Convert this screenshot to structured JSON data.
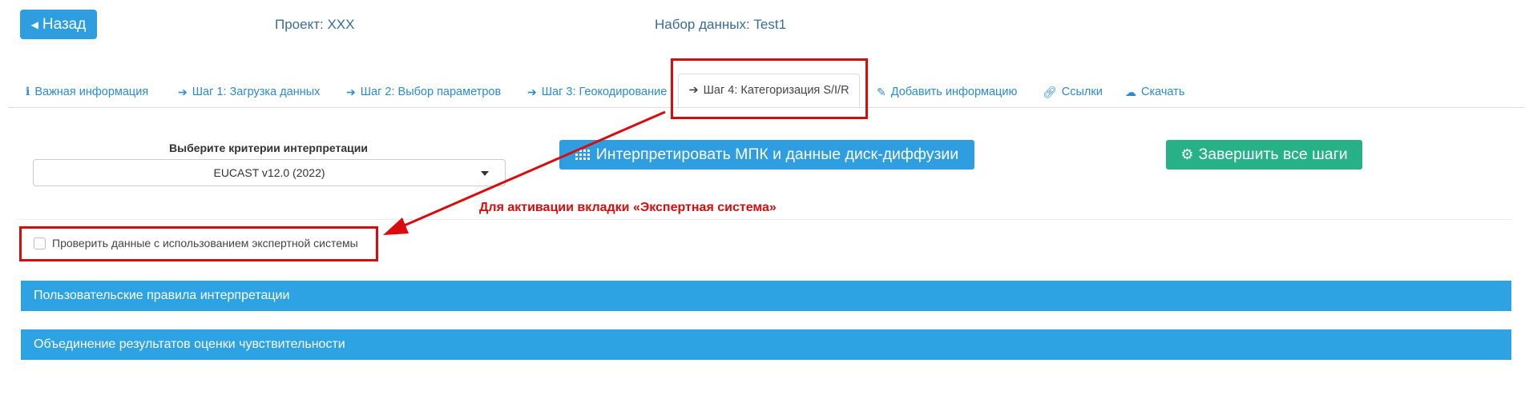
{
  "header": {
    "back_label": "Назад",
    "project": "Проект: XXX",
    "dataset": "Набор данных: Test1"
  },
  "tabs": [
    {
      "label": "Важная информация",
      "icon": "info-icon"
    },
    {
      "label": "Шаг 1: Загрузка данных",
      "icon": "arrow-right-icon"
    },
    {
      "label": "Шаг 2: Выбор параметров",
      "icon": "arrow-right-icon"
    },
    {
      "label": "Шаг 3: Геокодирование",
      "icon": "arrow-right-icon"
    },
    {
      "label": "Шаг 4: Категоризация S/I/R",
      "icon": "arrow-right-icon",
      "active": true
    },
    {
      "label": "Добавить информацию",
      "icon": "edit-icon"
    },
    {
      "label": "Ссылки",
      "icon": "link-icon"
    },
    {
      "label": "Скачать",
      "icon": "cloud-download-icon"
    }
  ],
  "form": {
    "criteria_label": "Выберите критерии интерпретации",
    "criteria_value": "EUCAST v12.0 (2022)",
    "interpret_button": "Интерпретировать МПК и данные диск-диффузии",
    "finish_button": "Завершить все шаги",
    "expert_checkbox_label": "Проверить данные с использованием экспертной системы",
    "expert_checked": false
  },
  "annotation": {
    "text": "Для активации вкладки «Экспертная система»",
    "color": "#d90d0d"
  },
  "panels": [
    {
      "title": "Пользовательские правила интерпретации"
    },
    {
      "title": "Объединение результатов оценки чувствительности"
    }
  ],
  "colors": {
    "primary": "#2e9ee0",
    "success": "#27b187",
    "link": "#2a8bd4",
    "highlight": "#d80c0c"
  }
}
